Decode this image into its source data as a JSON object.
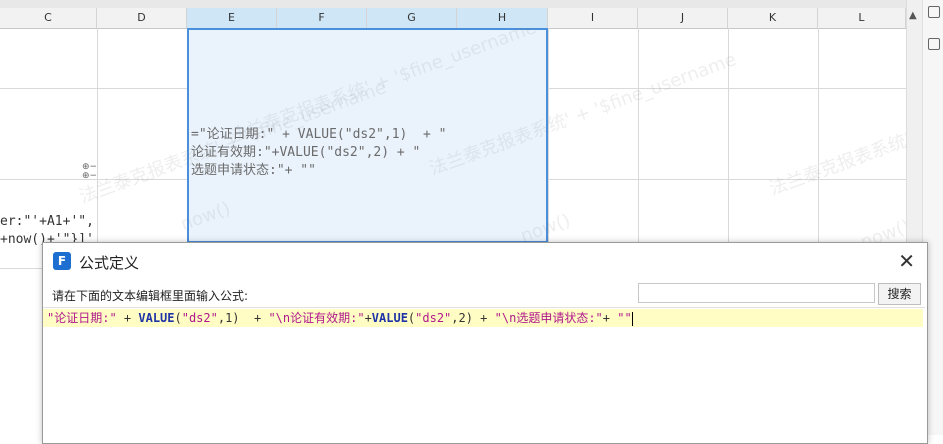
{
  "columns": [
    "C",
    "D",
    "E",
    "F",
    "G",
    "H",
    "I",
    "J",
    "K",
    "L"
  ],
  "merged_cell_text": "=\"论证日期:\" + VALUE(\"ds2\",1)  + \"\n论证有效期:\"+VALUE(\"ds2\",2) + \"\n选题申请状态:\"+ \"\"",
  "left_cell_text": "er:\"'+A1+'\",\n+now()+'\"}]'",
  "watermark_texts": [
    "法兰泰克报表系统' + '$fine_username",
    "now()"
  ],
  "dialog": {
    "title": "公式定义",
    "prompt": "请在下面的文本编辑框里面输入公式:",
    "search_placeholder": "",
    "search_button": "搜索",
    "formula_tokens": [
      {
        "t": "\"论证日期:\"",
        "k": "str"
      },
      {
        "t": " + ",
        "k": "op"
      },
      {
        "t": "VALUE",
        "k": "kw"
      },
      {
        "t": "(",
        "k": "op"
      },
      {
        "t": "\"ds2\"",
        "k": "str"
      },
      {
        "t": ",1)  + ",
        "k": "op"
      },
      {
        "t": "\"\\n论证有效期:\"",
        "k": "str"
      },
      {
        "t": "+",
        "k": "op"
      },
      {
        "t": "VALUE",
        "k": "kw"
      },
      {
        "t": "(",
        "k": "op"
      },
      {
        "t": "\"ds2\"",
        "k": "str"
      },
      {
        "t": ",2) + ",
        "k": "op"
      },
      {
        "t": "\"\\n选题申请状态:\"",
        "k": "str"
      },
      {
        "t": "+ ",
        "k": "op"
      },
      {
        "t": "\"\"",
        "k": "str"
      }
    ]
  }
}
